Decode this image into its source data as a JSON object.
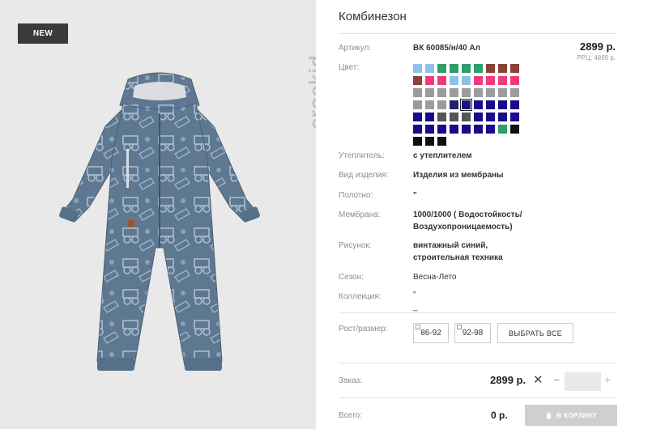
{
  "photo": {
    "badge": "NEW",
    "brand": "crockid"
  },
  "product": {
    "title": "Комбинезон",
    "price": "2899 р.",
    "rrp": "РРЦ: 4899 р."
  },
  "labels": {
    "article": "Артикул:",
    "color": "Цвет:",
    "insulation": "Утеплитель:",
    "type": "Вид изделия:",
    "fabric": "Полотно:",
    "membrane": "Мембрана:",
    "pattern": "Рисунок:",
    "season": "Сезон:",
    "collection": "Коллекция:",
    "size": "Рост/размер:"
  },
  "values": {
    "article": "ВК 60085/н/40 Ал",
    "insulation": "с утеплителем",
    "type": "Изделия из мембраны",
    "fabric": "\"",
    "membrane": "1000/1000 ( Водостойкость/ Воздухопроницаемость)",
    "pattern": "винтажный синий, строительная техника",
    "season": "Весна-Лето",
    "collection": "\" _"
  },
  "swatch_rows": [
    [
      "#8fc1e8",
      "#8fc1e8",
      "#2e9e6a",
      "#2e9e6a",
      "#2e9e6a",
      "#2e9e6a",
      "#8a4238",
      "#8a4238",
      "#8a4238"
    ],
    [
      "#8a4238",
      "#ef3b7d",
      "#ef3b7d",
      "#8fc1e8",
      "#8fc1e8",
      "#ef3b7d",
      "#ef3b7d",
      "#ef3b7d",
      "#ef3b7d"
    ],
    [
      "#9c9c9c",
      "#9c9c9c",
      "#9c9c9c",
      "#9c9c9c",
      "#9c9c9c",
      "#9c9c9c",
      "#9c9c9c",
      "#9c9c9c",
      "#9c9c9c"
    ],
    [
      "#9c9c9c",
      "#9c9c9c",
      "#9c9c9c",
      "#22216e",
      "#1f1478",
      "#1a0b8c",
      "#1a0b8c",
      "#1a0b8c",
      "#1a0b8c"
    ],
    [
      "#1a0b8c",
      "#1a0b8c",
      "#555555",
      "#555555",
      "#555555",
      "#1a0b8c",
      "#1a0b8c",
      "#1a0b8c",
      "#1a0b8c"
    ],
    [
      "#1a0b8c",
      "#1a0b8c",
      "#1a0b8c",
      "#1a0b8c",
      "#1a0b8c",
      "#1a0b8c",
      "#1a0b8c",
      "#2e9e6a",
      "#111111"
    ],
    [
      "#111111",
      "#111111",
      "#111111"
    ]
  ],
  "sizes": [
    "86-92",
    "92-98"
  ],
  "select_all": "ВЫБРАТЬ ВСЕ",
  "order": {
    "label": "Заказ:",
    "price": "2899 р.",
    "qty": ""
  },
  "total": {
    "label": "Всего:",
    "price": "0 р.",
    "cart_button": "В КОРЗИНУ"
  }
}
